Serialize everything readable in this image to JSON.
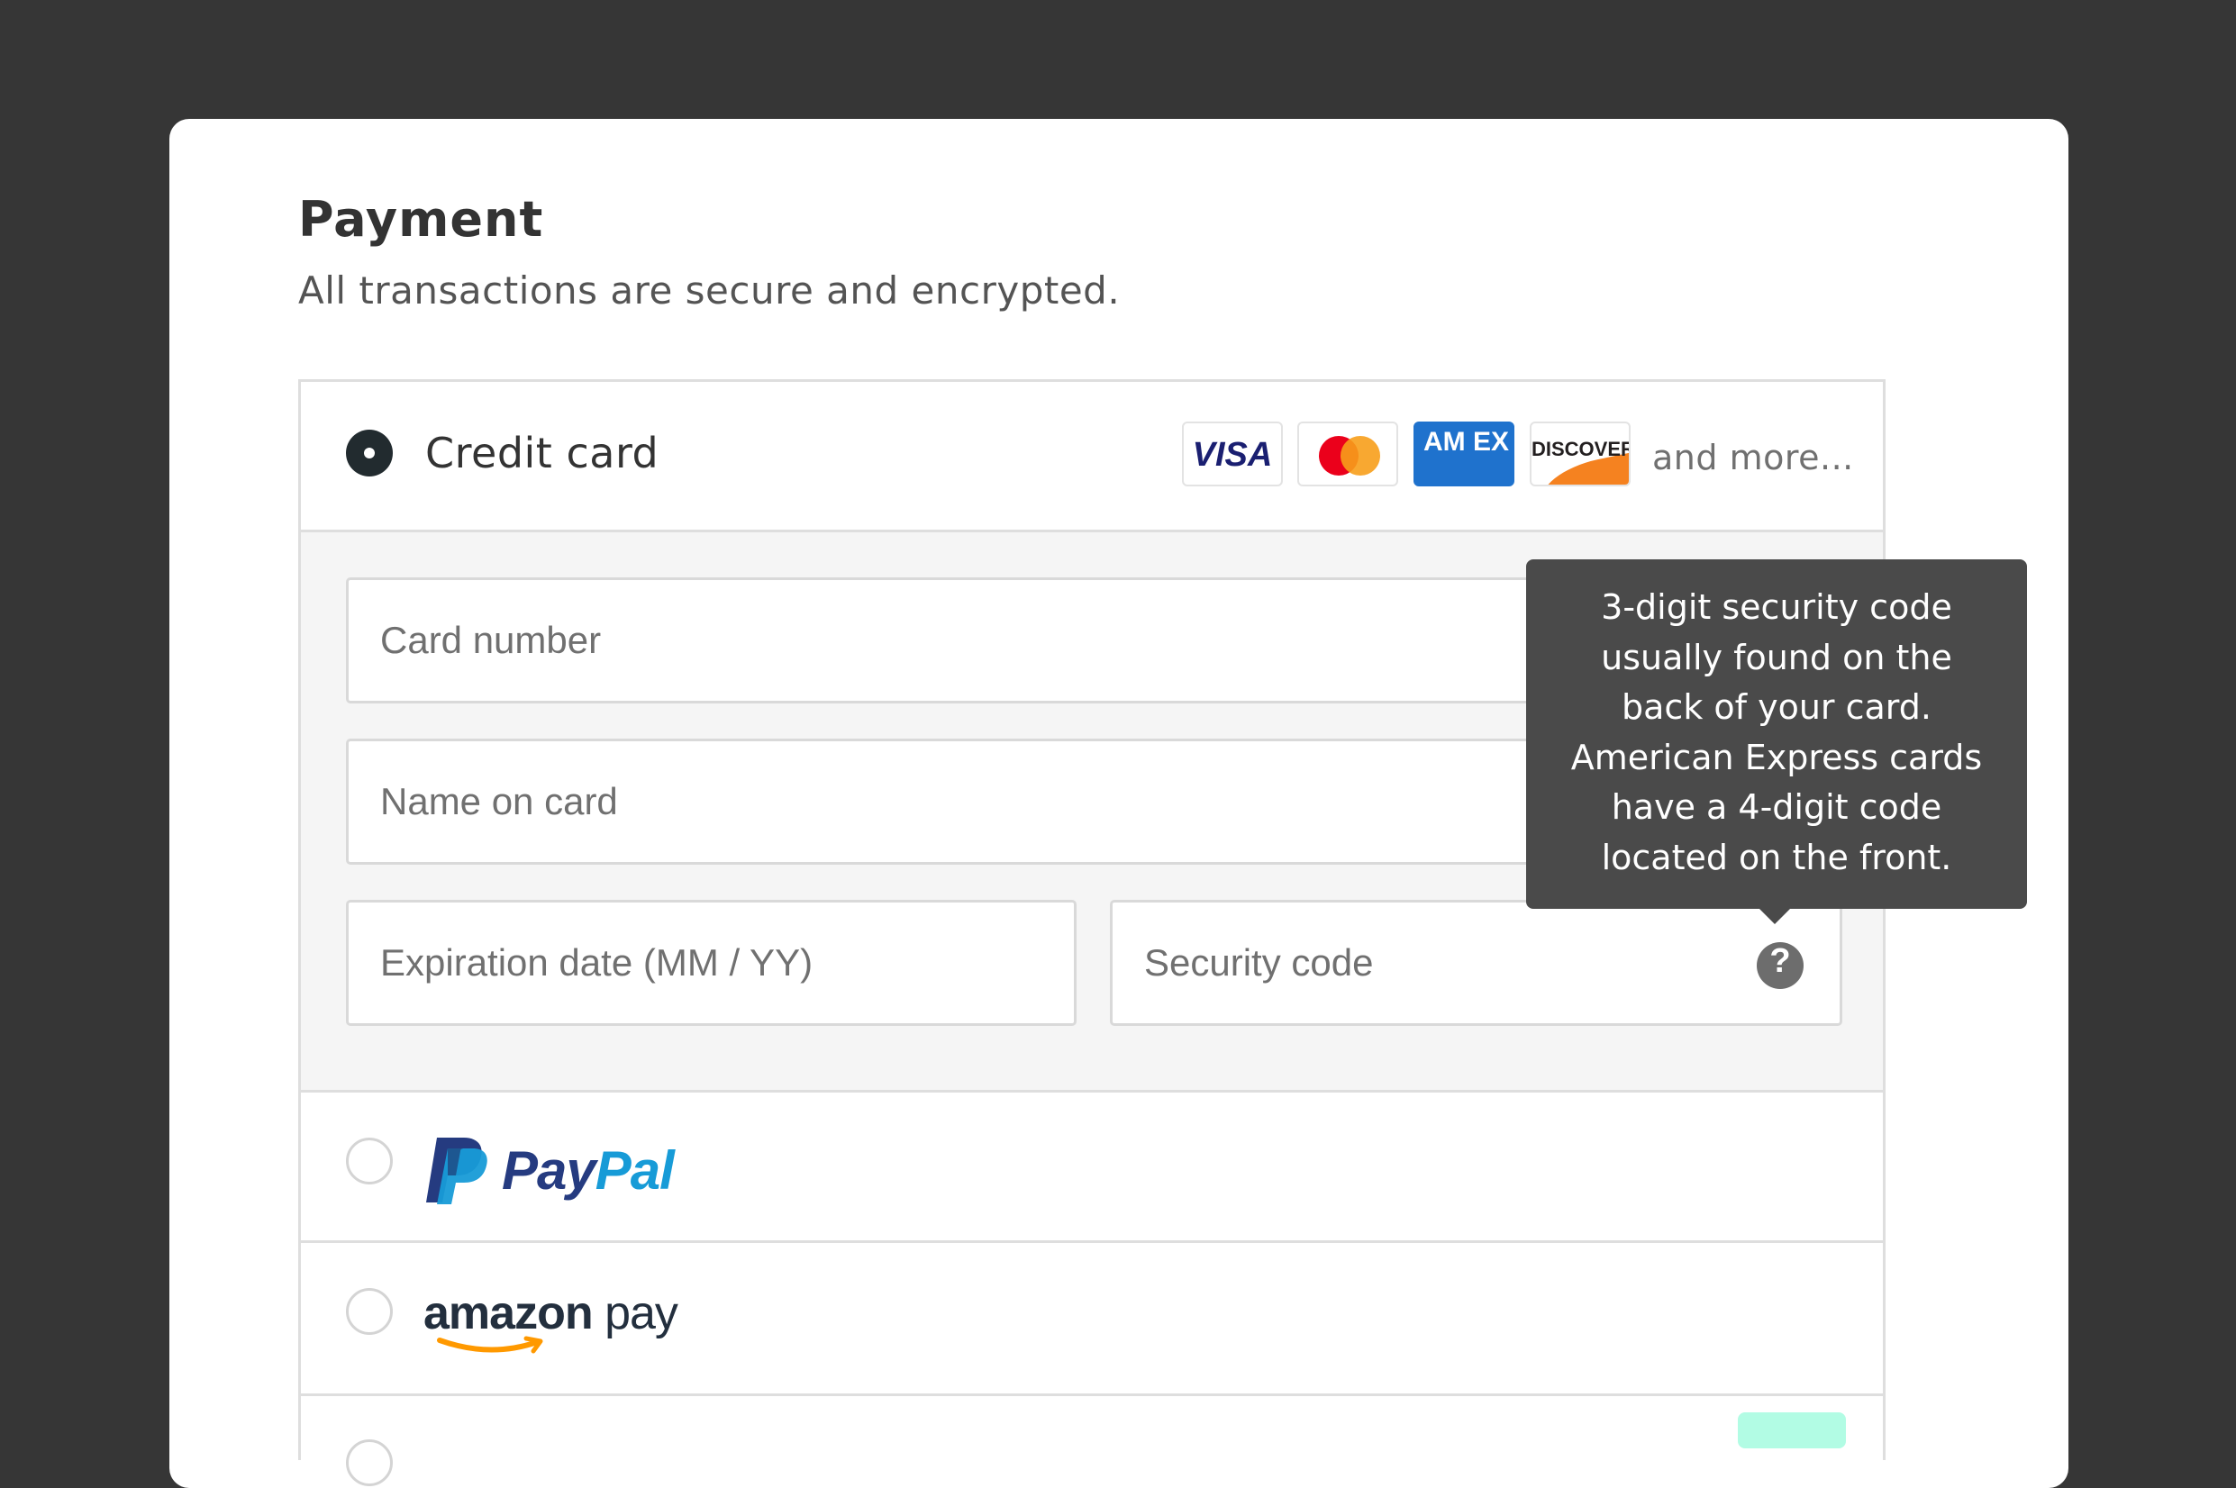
{
  "payment": {
    "title": "Payment",
    "subtitle": "All transactions are secure and encrypted."
  },
  "methods": {
    "credit_card": {
      "label": "Credit card",
      "selected": true,
      "brands": [
        "VISA",
        "AM EX",
        "DISCOVER"
      ],
      "brand_icons": [
        "visa-logo-icon",
        "mastercard-logo-icon",
        "amex-logo-icon",
        "discover-logo-icon"
      ],
      "and_more": "and more..."
    },
    "paypal": {
      "logo_pay": "Pay",
      "logo_pal": "Pal",
      "selected": false
    },
    "amazon_pay": {
      "logo_amazon": "amazon",
      "logo_pay": "pay",
      "selected": false
    }
  },
  "form": {
    "card_number_placeholder": "Card number",
    "name_on_card_placeholder": "Name on card",
    "expiration_placeholder": "Expiration date (MM / YY)",
    "security_code_placeholder": "Security code",
    "help_icon": "?"
  },
  "tooltip": {
    "lines": [
      "3-digit security code",
      "usually found on the",
      "back of your card.",
      "American Express cards",
      "have a 4-digit code",
      "located on the front."
    ]
  },
  "colors": {
    "background": "#363636",
    "radio_selected": "#222b2f",
    "tooltip_bg": "#4a4a4a",
    "paypal_dark": "#253b80",
    "paypal_light": "#179bd7",
    "amazon_smile": "#ff9900",
    "amex_blue": "#1f72cd",
    "next_badge": "#b2fce4"
  }
}
